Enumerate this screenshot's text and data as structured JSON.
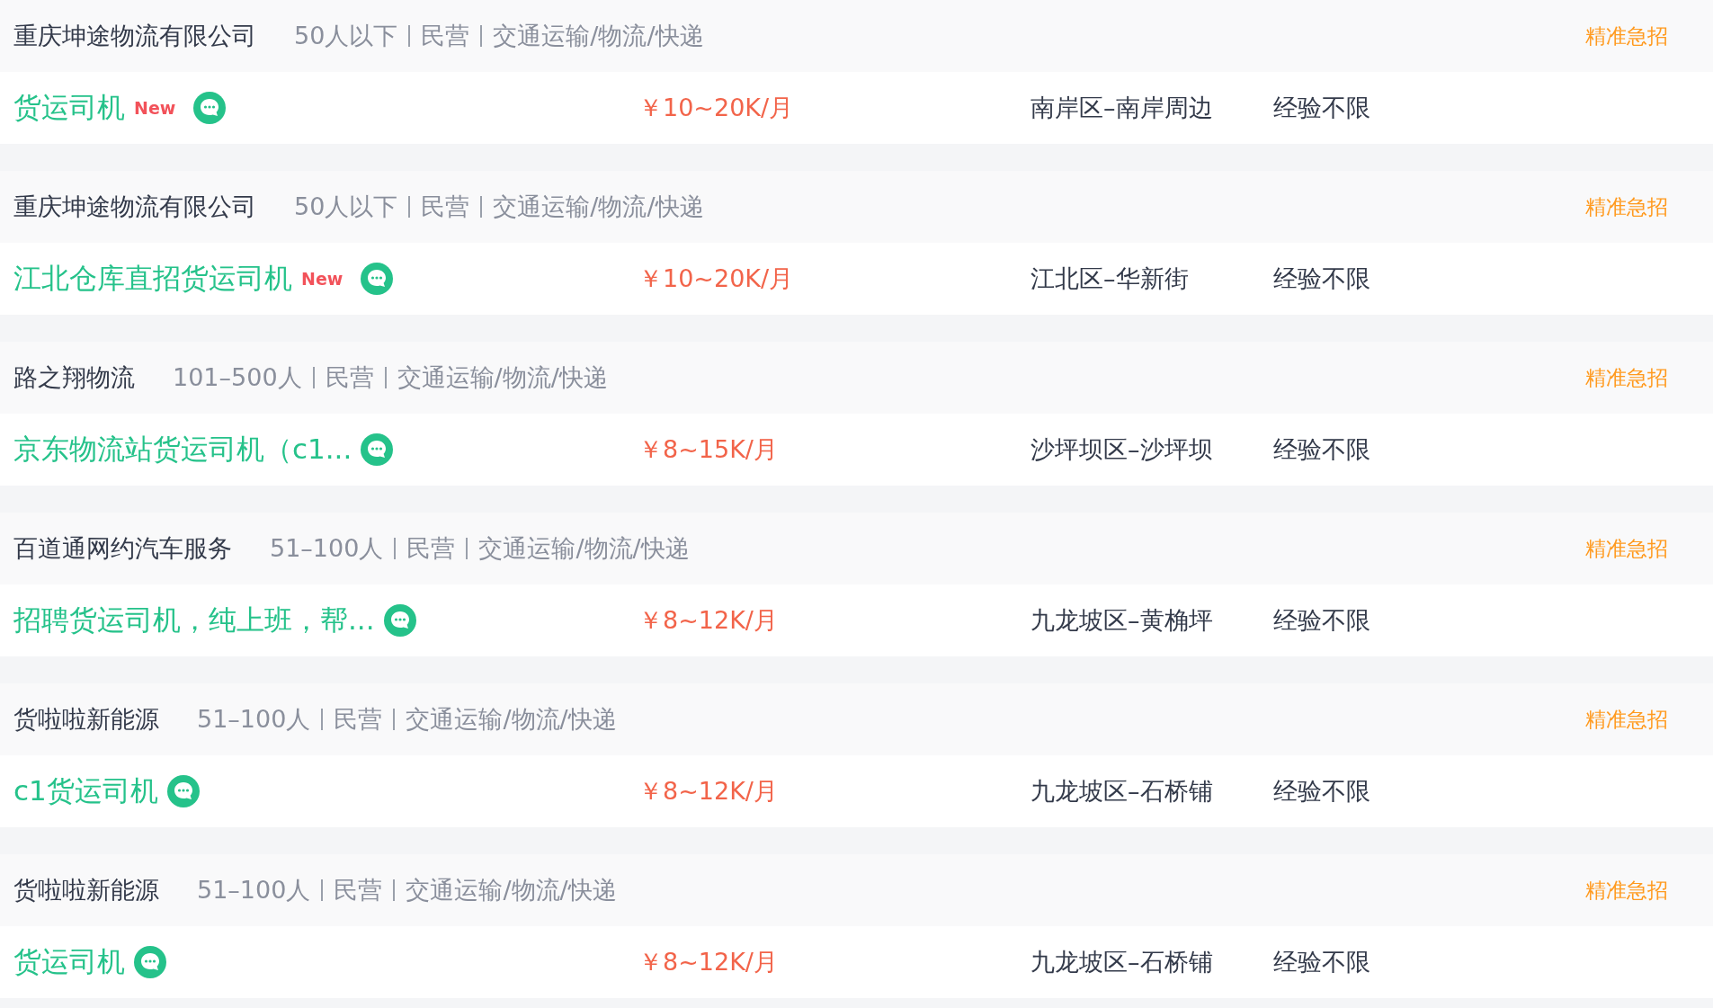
{
  "jobs": [
    {
      "company": "重庆坤途物流有限公司",
      "meta": [
        "50人以下",
        "民营",
        "交通运输/物流/快递"
      ],
      "tag": "精准急招",
      "title": "货运司机",
      "badge": "New",
      "salary": "￥10~20K/月",
      "location": "南岸区–南岸周边",
      "experience": "经验不限"
    },
    {
      "company": "重庆坤途物流有限公司",
      "meta": [
        "50人以下",
        "民营",
        "交通运输/物流/快递"
      ],
      "tag": "精准急招",
      "title": "江北仓库直招货运司机",
      "badge": "New",
      "salary": "￥10~20K/月",
      "location": "江北区–华新街",
      "experience": "经验不限"
    },
    {
      "company": "路之翔物流",
      "meta": [
        "101–500人",
        "民营",
        "交通运输/物流/快递"
      ],
      "tag": "精准急招",
      "title": "京东物流站货运司机（c1...",
      "salary": "￥8~15K/月",
      "location": "沙坪坝区–沙坪坝",
      "experience": "经验不限"
    },
    {
      "company": "百道通网约汽车服务",
      "meta": [
        "51–100人",
        "民营",
        "交通运输/物流/快递"
      ],
      "tag": "精准急招",
      "title": "招聘货运司机，纯上班，帮...",
      "salary": "￥8~12K/月",
      "location": "九龙坡区–黄桷坪",
      "experience": "经验不限"
    },
    {
      "company": "货啦啦新能源",
      "meta": [
        "51–100人",
        "民营",
        "交通运输/物流/快递"
      ],
      "tag": "精准急招",
      "title": "c1货运司机",
      "salary": "￥8~12K/月",
      "location": "九龙坡区–石桥铺",
      "experience": "经验不限"
    },
    {
      "company": "货啦啦新能源",
      "meta": [
        "51–100人",
        "民营",
        "交通运输/物流/快递"
      ],
      "tag": "精准急招",
      "title": "货运司机",
      "salary": "￥8~12K/月",
      "location": "九龙坡区–石桥铺",
      "experience": "经验不限"
    }
  ]
}
